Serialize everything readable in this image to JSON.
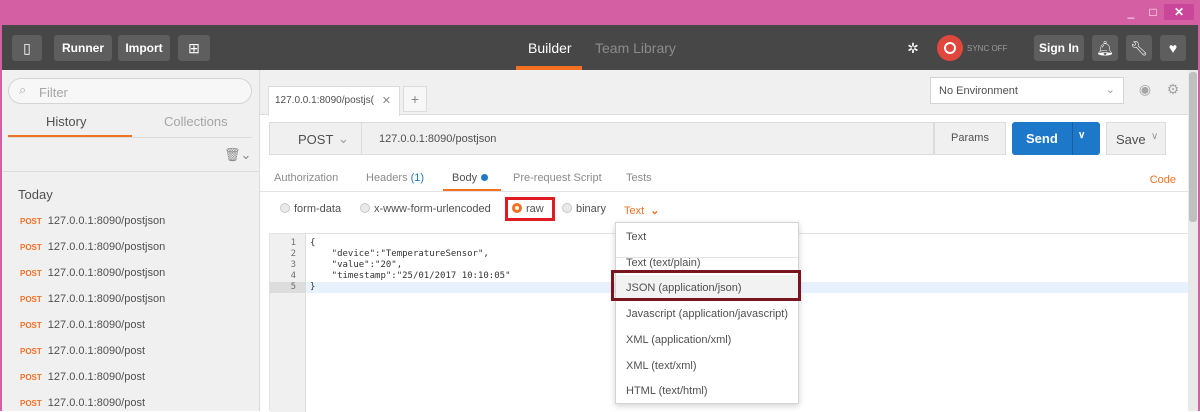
{
  "window": {
    "min": "_",
    "max": "□",
    "close": "✕"
  },
  "header": {
    "runner": "Runner",
    "import": "Import",
    "builder": "Builder",
    "team_library": "Team Library",
    "sync": "SYNC OFF",
    "sign_in": "Sign In"
  },
  "sidebar": {
    "filter_placeholder": "Filter",
    "tab_history": "History",
    "tab_collections": "Collections",
    "section": "Today",
    "items": [
      {
        "method": "POST",
        "url": "127.0.0.1:8090/postjson"
      },
      {
        "method": "POST",
        "url": "127.0.0.1:8090/postjson"
      },
      {
        "method": "POST",
        "url": "127.0.0.1:8090/postjson"
      },
      {
        "method": "POST",
        "url": "127.0.0.1:8090/postjson"
      },
      {
        "method": "POST",
        "url": "127.0.0.1:8090/post"
      },
      {
        "method": "POST",
        "url": "127.0.0.1:8090/post"
      },
      {
        "method": "POST",
        "url": "127.0.0.1:8090/post"
      },
      {
        "method": "POST",
        "url": "127.0.0.1:8090/post"
      }
    ]
  },
  "request": {
    "tab_title": "127.0.0.1:8090/postjs(",
    "environment": "No Environment",
    "method": "POST",
    "url": "127.0.0.1:8090/postjson",
    "params": "Params",
    "send": "Send",
    "save": "Save"
  },
  "tabs": {
    "authorization": "Authorization",
    "headers": "Headers",
    "headers_count": "(1)",
    "body": "Body",
    "prerequest": "Pre-request Script",
    "tests": "Tests",
    "code": "Code"
  },
  "body_modes": {
    "form_data": "form-data",
    "urlencoded": "x-www-form-urlencoded",
    "raw": "raw",
    "binary": "binary",
    "format": "Text"
  },
  "editor": {
    "lines": [
      {
        "n": "1",
        "text": "{"
      },
      {
        "n": "2",
        "text": "    \"device\":\"TemperatureSensor\","
      },
      {
        "n": "3",
        "text": "    \"value\":\"20\","
      },
      {
        "n": "4",
        "text": "    \"timestamp\":\"25/01/2017 10:10:05\""
      },
      {
        "n": "5",
        "text": "}"
      }
    ]
  },
  "dropdown": {
    "options": [
      "Text",
      "Text (text/plain)",
      "JSON (application/json)",
      "Javascript (application/javascript)",
      "XML (application/xml)",
      "XML (text/xml)",
      "HTML (text/html)"
    ],
    "highlighted": "JSON (application/json)"
  },
  "colors": {
    "accent": "#f47023",
    "send": "#1d78c9",
    "header": "#474747",
    "highlight_box": "#e01b24"
  }
}
